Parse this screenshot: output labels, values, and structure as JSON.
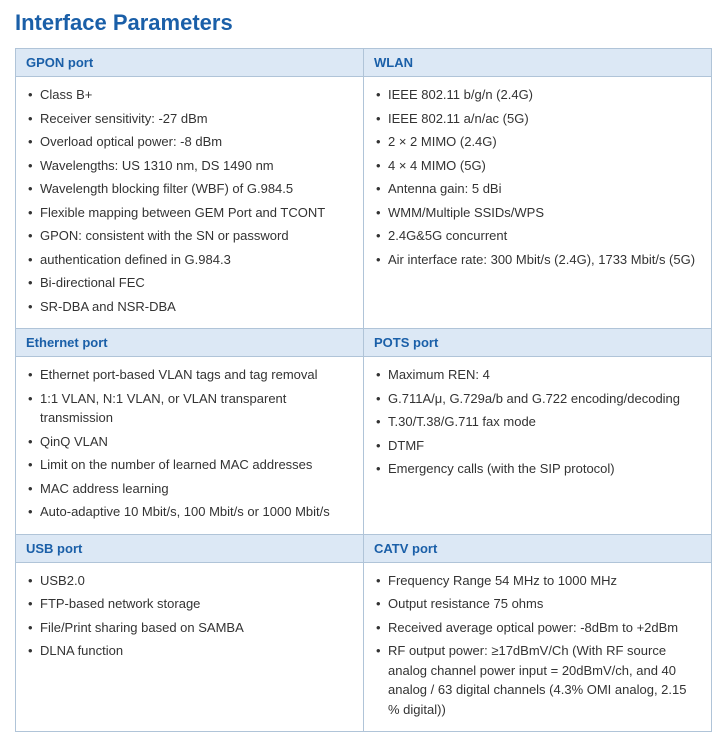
{
  "title": "Interface Parameters",
  "sections": [
    {
      "id": "gpon",
      "header": "GPON port",
      "items": [
        "Class B+",
        "Receiver sensitivity: -27 dBm",
        "Overload optical power: -8 dBm",
        "Wavelengths: US 1310 nm, DS 1490 nm",
        "Wavelength blocking filter (WBF) of G.984.5",
        "Flexible mapping between GEM Port and TCONT",
        "GPON: consistent with the SN or password",
        "authentication defined in G.984.3",
        "Bi-directional FEC",
        "SR-DBA and NSR-DBA"
      ]
    },
    {
      "id": "wlan",
      "header": "WLAN",
      "items": [
        "IEEE 802.11 b/g/n (2.4G)",
        "IEEE 802.11 a/n/ac (5G)",
        "2 × 2 MIMO (2.4G)",
        "4 × 4 MIMO (5G)",
        "Antenna gain: 5 dBi",
        "WMM/Multiple SSIDs/WPS",
        "2.4G&5G concurrent",
        "Air interface rate:   300 Mbit/s (2.4G), 1733 Mbit/s (5G)"
      ]
    },
    {
      "id": "ethernet",
      "header": "Ethernet port",
      "items": [
        "Ethernet port-based VLAN tags and tag removal",
        "1:1 VLAN, N:1 VLAN, or VLAN transparent transmission",
        "QinQ VLAN",
        "Limit on the number of learned MAC addresses",
        "MAC address learning",
        "Auto-adaptive 10 Mbit/s, 100 Mbit/s or 1000 Mbit/s"
      ]
    },
    {
      "id": "pots",
      "header": "POTS port",
      "items": [
        "Maximum REN: 4",
        "G.711A/μ, G.729a/b and G.722 encoding/decoding",
        "T.30/T.38/G.711 fax mode",
        "DTMF",
        "Emergency calls (with the SIP protocol)"
      ]
    },
    {
      "id": "usb",
      "header": "USB port",
      "items": [
        "USB2.0",
        "FTP-based network storage",
        "File/Print sharing based on SAMBA",
        "DLNA function"
      ]
    },
    {
      "id": "catv",
      "header": "CATV port",
      "items": [
        "Frequency Range 54 MHz to 1000 MHz",
        "Output resistance 75 ohms",
        "Received average optical power: -8dBm to +2dBm",
        "RF output power: ≥17dBmV/Ch (With RF source analog channel power input = 20dBmV/ch, and 40 analog / 63 digital channels (4.3% OMI analog, 2.15 % digital))"
      ]
    }
  ]
}
